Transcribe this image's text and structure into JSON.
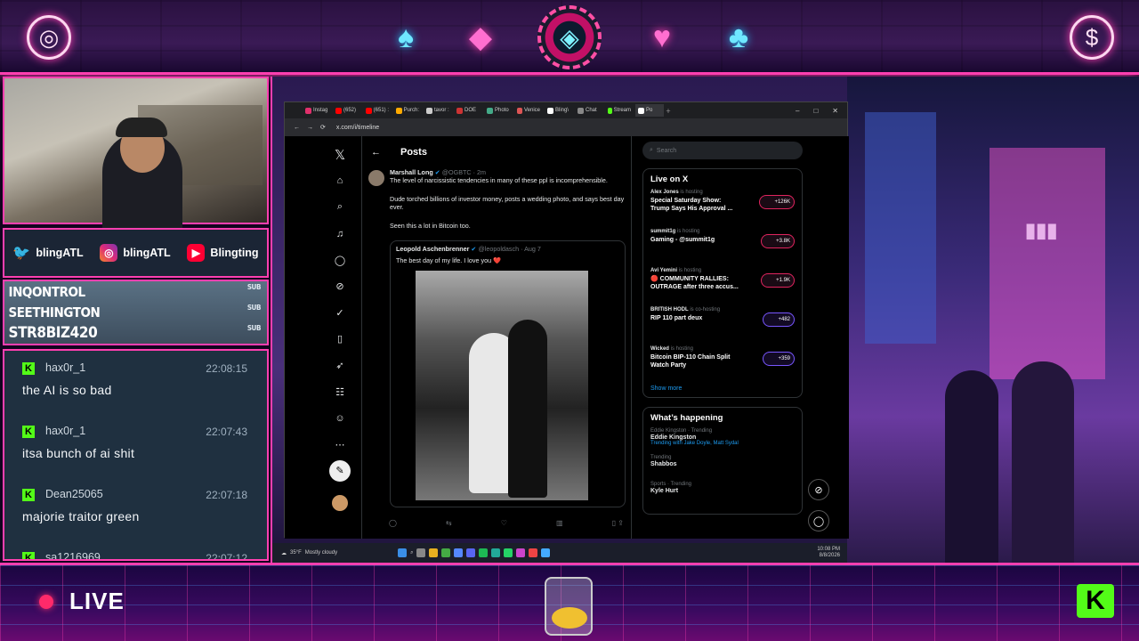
{
  "overlay": {
    "top_icons": [
      "vinyl-icon",
      "spade-icon",
      "diamond-icon",
      "chip-icon",
      "heart-icon",
      "club-icon",
      "dollar-icon"
    ],
    "socials": [
      {
        "platform": "twitter",
        "handle": "blingATL",
        "color": "#1d9bf0"
      },
      {
        "platform": "instagram",
        "handle": "blingATL",
        "color": "#e1306c"
      },
      {
        "platform": "youtube",
        "handle": "Blingting",
        "color": "#ff0033"
      }
    ],
    "subs": [
      {
        "name": "INQONTROL",
        "tag": "SUB"
      },
      {
        "name": "SEETHINGTON",
        "tag": "SUB"
      },
      {
        "name": "STR8BIZ420",
        "tag": "SUB"
      }
    ],
    "chat": [
      {
        "user": "hax0r_1",
        "time": "22:08:15",
        "text": "the AI is so bad"
      },
      {
        "user": "hax0r_1",
        "time": "22:07:43",
        "text": "itsa bunch of ai shit"
      },
      {
        "user": "Dean25065",
        "time": "22:07:18",
        "text": "majorie traitor green"
      },
      {
        "user": "sa1216969",
        "time": "22:07:12",
        "text": ""
      }
    ],
    "live_label": "LIVE",
    "kick_logo": "K"
  },
  "browser": {
    "tabs": [
      "Instag",
      "(652)",
      "(651) :",
      "Purch:",
      "tavor :",
      "DOE",
      "Photo",
      "Venice",
      "Bling\\",
      "Chat",
      "Stream",
      "Po"
    ],
    "url": "x.com/i/timeline",
    "window_controls": [
      "–",
      "□",
      "✕"
    ]
  },
  "x": {
    "page_title": "Posts",
    "post": {
      "author": "Marshall Long",
      "handle": "@OGBTC",
      "age": "· 2m",
      "p1": "The level of narcissistic tendencies in many of these ppl is incomprehensible.",
      "p2": "Dude torched billions of investor money, posts a wedding photo, and says best day ever.",
      "p3": "Seen this a lot in Bitcoin too."
    },
    "quote": {
      "author": "Leopold Aschenbrenner",
      "handle": "@leopoldasch",
      "age": "· Aug 7",
      "text": "The best day of my life. I love you ❤️"
    },
    "search_placeholder": "Search",
    "live_title": "Live on X",
    "live": [
      {
        "host": "Alex Jones",
        "role": "is hosting",
        "title": "Special Saturday Show: Trump Says His Approval ...",
        "count": "+126K"
      },
      {
        "host": "summit1g",
        "role": "is hosting",
        "title": "Gaming - @summit1g",
        "count": "+3.8K"
      },
      {
        "host": "Avi Yemini",
        "role": "is hosting",
        "title": "🔴 COMMUNITY RALLIES: OUTRAGE after three accus...",
        "count": "+1.9K"
      },
      {
        "host": "BRITISH HODL",
        "role": "is co-hosting",
        "title": "RIP 110 part deux",
        "count": "+482"
      },
      {
        "host": "Wicked",
        "role": "is hosting",
        "title": "Bitcoin BIP-110 Chain Split Watch Party",
        "count": "+359"
      }
    ],
    "show_more": "Show more",
    "happening_title": "What’s happening",
    "trends": [
      {
        "meta": "Eddie Kingston · Trending",
        "name": "Eddie Kingston",
        "extra": "Trending with Jake Doyle, Matt Sydal"
      },
      {
        "meta": "Trending",
        "name": "Shabbos",
        "extra": ""
      },
      {
        "meta": "Sports · Trending",
        "name": "Kyle Hurt",
        "extra": ""
      }
    ]
  },
  "taskbar": {
    "weather": "35°F",
    "weather_desc": "Mostly cloudy",
    "time": "10:08 PM",
    "date": "8/8/2026"
  }
}
